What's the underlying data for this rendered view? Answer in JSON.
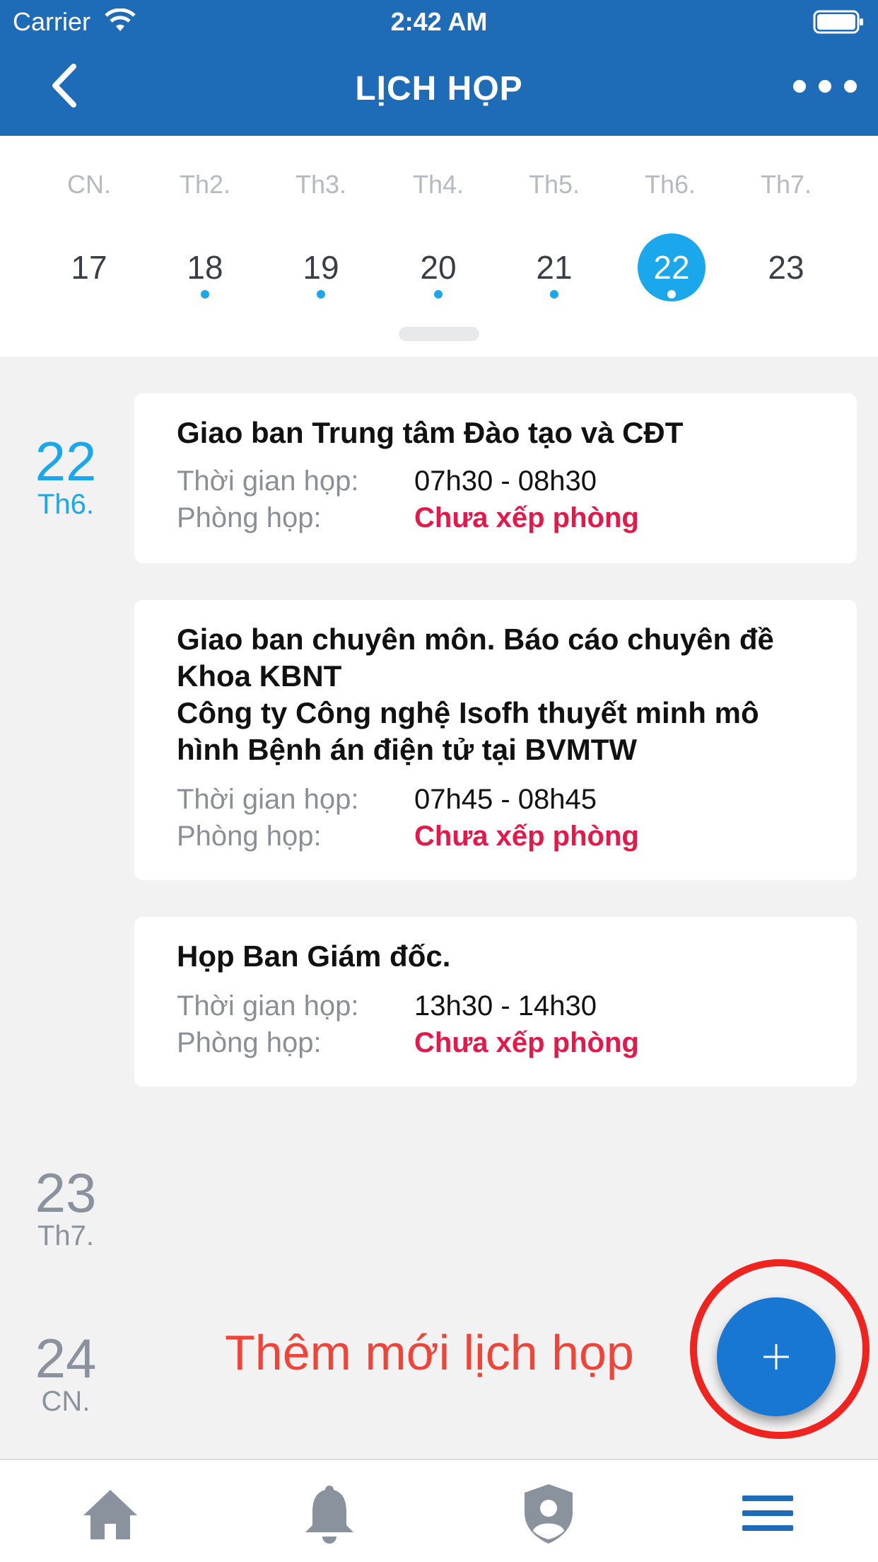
{
  "status_bar": {
    "carrier": "Carrier",
    "time": "2:42 AM"
  },
  "nav": {
    "title": "LỊCH HỌP"
  },
  "week": {
    "days": [
      {
        "weekday": "CN.",
        "day": "17",
        "has_event": false,
        "selected": false
      },
      {
        "weekday": "Th2.",
        "day": "18",
        "has_event": true,
        "selected": false
      },
      {
        "weekday": "Th3.",
        "day": "19",
        "has_event": true,
        "selected": false
      },
      {
        "weekday": "Th4.",
        "day": "20",
        "has_event": true,
        "selected": false
      },
      {
        "weekday": "Th5.",
        "day": "21",
        "has_event": true,
        "selected": false
      },
      {
        "weekday": "Th6.",
        "day": "22",
        "has_event": true,
        "selected": true
      },
      {
        "weekday": "Th7.",
        "day": "23",
        "has_event": false,
        "selected": false
      }
    ]
  },
  "agenda": {
    "dates": [
      {
        "num": "22",
        "dow": "Th6."
      },
      {
        "num": "23",
        "dow": "Th7."
      },
      {
        "num": "24",
        "dow": "CN."
      }
    ],
    "meetings": [
      {
        "title_lines": [
          "Giao ban Trung tâm Đào tạo và CĐT"
        ],
        "time_label": "Thời gian họp:",
        "time": "07h30 - 08h30",
        "room_label": "Phòng họp:",
        "room": "Chưa xếp phòng"
      },
      {
        "title_lines": [
          "Giao ban chuyên môn. Báo cáo chuyên đề",
          "Khoa KBNT",
          "Công ty Công nghệ Isofh thuyết minh mô",
          "hình Bệnh án điện tử tại BVMTW"
        ],
        "time_label": "Thời gian họp:",
        "time": "07h45 - 08h45",
        "room_label": "Phòng họp:",
        "room": "Chưa xếp phòng"
      },
      {
        "title_lines": [
          "Họp Ban Giám đốc."
        ],
        "time_label": "Thời gian họp:",
        "time": "13h30 - 14h30",
        "room_label": "Phòng họp:",
        "room": "Chưa xếp phòng"
      }
    ]
  },
  "fab": {
    "label": "Thêm mới lịch họp",
    "icon": "plus-icon"
  },
  "tabbar": {
    "icons": [
      "home-icon",
      "bell-icon",
      "shield-user-icon",
      "menu-icon"
    ]
  },
  "colors": {
    "header": "#1e6bb8",
    "accent": "#1aa7ec",
    "warning": "#e5184a",
    "fab": "#1877d2",
    "highlight_ring": "#f0241e"
  }
}
